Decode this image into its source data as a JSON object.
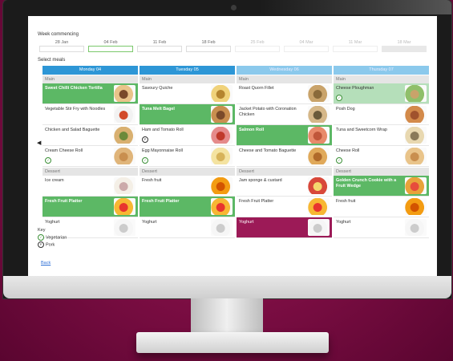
{
  "page": {
    "week_label": "Week commencing",
    "select_label": "Select meals",
    "back_label": "Back"
  },
  "weeks": [
    "28 Jan",
    "04 Feb",
    "11 Feb",
    "18 Feb",
    "25 Feb",
    "04 Mar",
    "11 Mar",
    "18 Mar"
  ],
  "selected_week": "04 Feb",
  "days": [
    {
      "name": "Monday 04",
      "main_label": "Main",
      "main": [
        {
          "name": "Sweet Chilli Chicken Tortilla",
          "selected": true,
          "img": "wrap"
        },
        {
          "name": "Vegetable Stir Fry with Noodles",
          "selected": false,
          "img": "noodles"
        },
        {
          "name": "Chicken and Salad Baguette",
          "selected": false,
          "img": "baguette"
        },
        {
          "name": "Cream Cheese Roll",
          "selected": false,
          "badge": "veg",
          "img": "roll"
        }
      ],
      "dessert_label": "Dessert",
      "dessert": [
        {
          "name": "Ice cream",
          "selected": false,
          "img": "icecream"
        },
        {
          "name": "Fresh Fruit Platter",
          "selected": true,
          "img": "fruit"
        },
        {
          "name": "Yoghurt",
          "selected": false,
          "img": "yoghurt"
        }
      ]
    },
    {
      "name": "Tuesday 05",
      "main_label": "Main",
      "main": [
        {
          "name": "Savoury Quiche",
          "selected": false,
          "img": "quiche"
        },
        {
          "name": "Tuna Melt Bagel",
          "selected": true,
          "img": "bagel"
        },
        {
          "name": "Ham and Tomato Roll",
          "selected": false,
          "badge": "pork",
          "img": "ham"
        },
        {
          "name": "Egg Mayonnaise Roll",
          "selected": false,
          "badge": "veg",
          "img": "egg"
        }
      ],
      "dessert_label": "Dessert",
      "dessert": [
        {
          "name": "Fresh fruit",
          "selected": false,
          "img": "fruitbowl"
        },
        {
          "name": "Fresh Fruit Platter",
          "selected": true,
          "img": "fruit"
        },
        {
          "name": "Yoghurt",
          "selected": false,
          "img": "yoghurt"
        }
      ]
    },
    {
      "name": "Wednesday 06",
      "main_label": "Main",
      "main": [
        {
          "name": "Roast Quorn Fillet",
          "selected": false,
          "img": "quorn"
        },
        {
          "name": "Jacket Potato with Coronation Chicken",
          "selected": false,
          "img": "potato"
        },
        {
          "name": "Salmon Roll",
          "selected": true,
          "img": "salmon"
        },
        {
          "name": "Cheese and Tomato Baguette",
          "selected": false,
          "img": "cheesebag"
        }
      ],
      "dessert_label": "Dessert",
      "dessert": [
        {
          "name": "Jam sponge & custard",
          "selected": false,
          "img": "sponge"
        },
        {
          "name": "Fresh Fruit Platter",
          "selected": false,
          "img": "fruit"
        },
        {
          "name": "Yoghurt",
          "selected": "pink",
          "img": "yoghurt"
        }
      ]
    },
    {
      "name": "Thursday 07",
      "main_label": "Main",
      "main": [
        {
          "name": "Cheese Ploughman",
          "selected": true,
          "badge": "veg",
          "img": "ploughman"
        },
        {
          "name": "Posh Dog",
          "selected": false,
          "img": "hotdog"
        },
        {
          "name": "Tuna and Sweetcorn Wrap",
          "selected": false,
          "img": "tunawrap"
        },
        {
          "name": "Cheese Roll",
          "selected": false,
          "badge": "veg",
          "img": "cheeseroll"
        }
      ],
      "dessert_label": "Dessert",
      "dessert": [
        {
          "name": "Golden Crunch Cookie with a Fruit Wedge",
          "selected": true,
          "img": "cookie"
        },
        {
          "name": "Fresh fruit",
          "selected": false,
          "img": "fruitbowl"
        },
        {
          "name": "Yoghurt",
          "selected": false,
          "img": "yoghurt"
        }
      ]
    }
  ],
  "key": {
    "title": "Key",
    "vegetarian": "Vegetarian",
    "pork": "Pork"
  },
  "colors": {
    "selected_green": "#5cb865",
    "day_header_blue": "#2d96d6",
    "accent_pink": "#9c1a57"
  }
}
